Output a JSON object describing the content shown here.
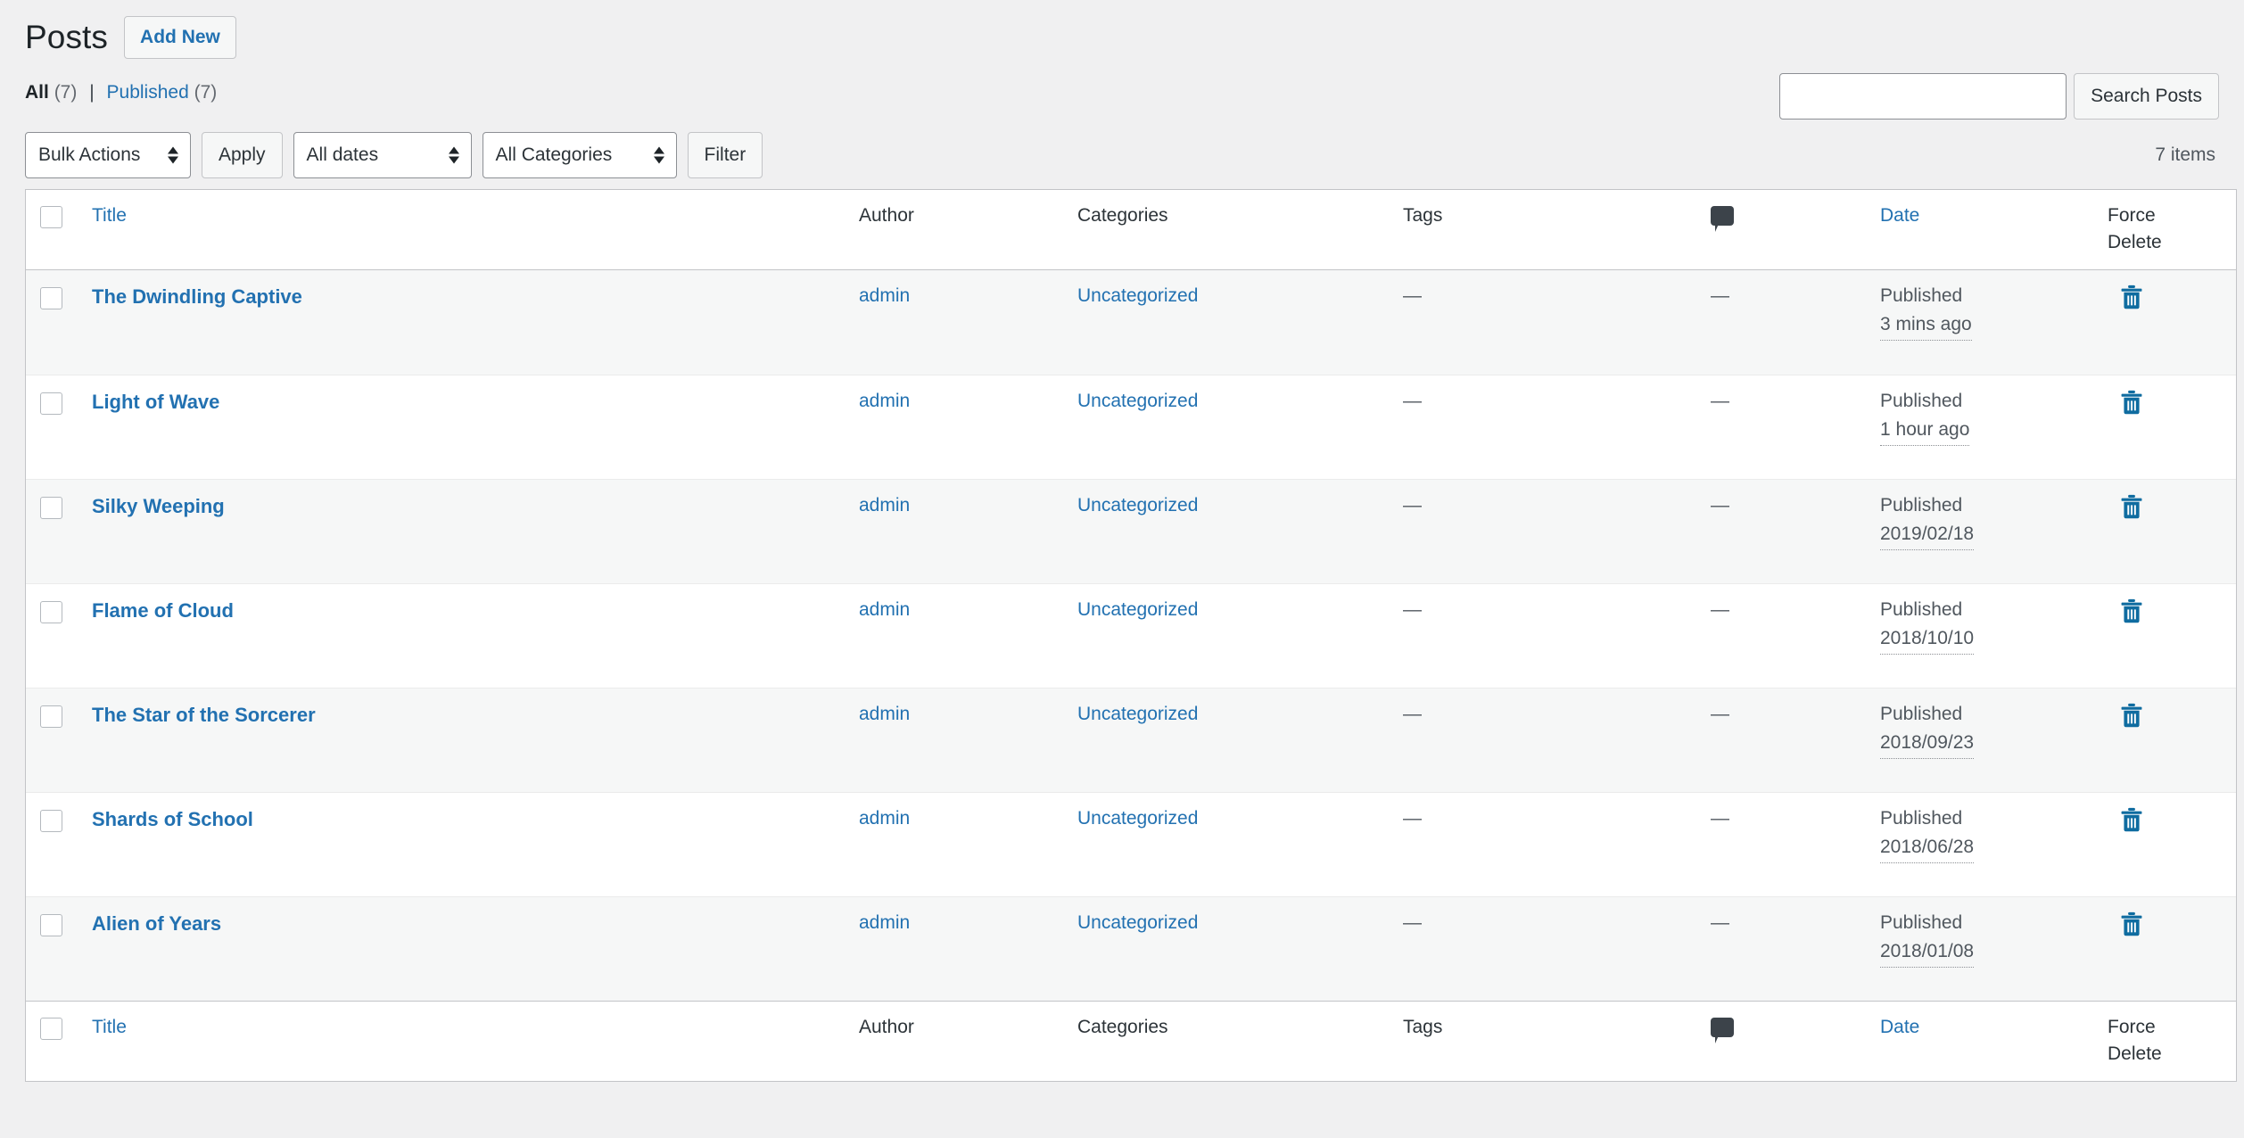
{
  "header": {
    "title": "Posts",
    "add_new_label": "Add New"
  },
  "views": {
    "all_label": "All",
    "all_count": "(7)",
    "separator": "|",
    "published_label": "Published",
    "published_count": "(7)"
  },
  "search": {
    "value": "",
    "placeholder": "",
    "button_label": "Search Posts"
  },
  "tablenav": {
    "bulk_actions_label": "Bulk Actions",
    "apply_label": "Apply",
    "all_dates_label": "All dates",
    "all_categories_label": "All Categories",
    "filter_label": "Filter",
    "displaying_num": "7 items"
  },
  "columns": {
    "title": "Title",
    "author": "Author",
    "categories": "Categories",
    "tags": "Tags",
    "comments_icon": "comment-bubble-icon",
    "date": "Date",
    "force_delete_line1": "Force",
    "force_delete_line2": "Delete"
  },
  "rows": [
    {
      "title": "The Dwindling Captive",
      "author": "admin",
      "categories": "Uncategorized",
      "tags": "—",
      "comments": "—",
      "date_status": "Published",
      "date_when": "3 mins ago",
      "delete_icon": "trash-icon"
    },
    {
      "title": "Light of Wave",
      "author": "admin",
      "categories": "Uncategorized",
      "tags": "—",
      "comments": "—",
      "date_status": "Published",
      "date_when": "1 hour ago",
      "delete_icon": "trash-icon"
    },
    {
      "title": "Silky Weeping",
      "author": "admin",
      "categories": "Uncategorized",
      "tags": "—",
      "comments": "—",
      "date_status": "Published",
      "date_when": "2019/02/18",
      "delete_icon": "trash-icon"
    },
    {
      "title": "Flame of Cloud",
      "author": "admin",
      "categories": "Uncategorized",
      "tags": "—",
      "comments": "—",
      "date_status": "Published",
      "date_when": "2018/10/10",
      "delete_icon": "trash-icon"
    },
    {
      "title": "The Star of the Sorcerer",
      "author": "admin",
      "categories": "Uncategorized",
      "tags": "—",
      "comments": "—",
      "date_status": "Published",
      "date_when": "2018/09/23",
      "delete_icon": "trash-icon"
    },
    {
      "title": "Shards of School",
      "author": "admin",
      "categories": "Uncategorized",
      "tags": "—",
      "comments": "—",
      "date_status": "Published",
      "date_when": "2018/06/28",
      "delete_icon": "trash-icon"
    },
    {
      "title": "Alien of Years",
      "author": "admin",
      "categories": "Uncategorized",
      "tags": "—",
      "comments": "—",
      "date_status": "Published",
      "date_when": "2018/01/08",
      "delete_icon": "trash-icon"
    }
  ],
  "colors": {
    "link_blue": "#2271b1",
    "page_background": "#f0f0f1",
    "row_alt": "#f6f7f7",
    "text_dark": "#1d2327",
    "text_muted": "#50575e",
    "border": "#c3c4c7",
    "comment_icon": "#3c434a",
    "trash_icon": "#0f6ca0"
  }
}
